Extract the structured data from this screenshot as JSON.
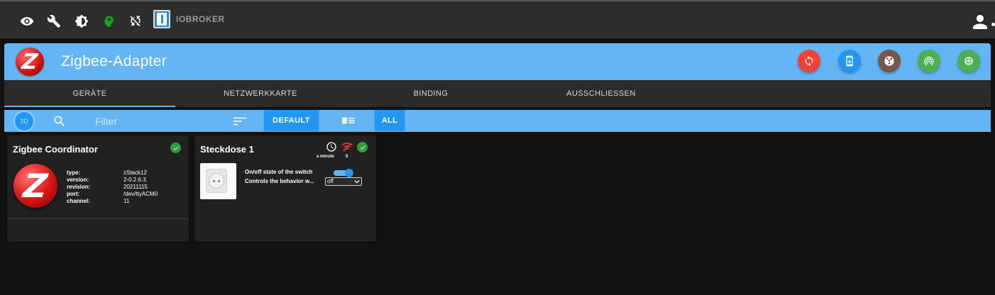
{
  "topbar": {
    "brand": "IOBROKER",
    "icons": [
      "eye-icon",
      "wrench-icon",
      "brightness-icon",
      "expert-mode-icon",
      "sync-icon"
    ]
  },
  "header": {
    "title": "Zigbee-Adapter",
    "buttons": [
      {
        "name": "refresh",
        "color": "#f44336"
      },
      {
        "name": "install",
        "color": "#2196f3"
      },
      {
        "name": "extension",
        "color": "#795548"
      },
      {
        "name": "pairing",
        "color": "#4caf50"
      },
      {
        "name": "memory",
        "color": "#4caf50"
      }
    ]
  },
  "tabs": [
    {
      "label": "GERÄTE",
      "active": true
    },
    {
      "label": "NETZWERKKARTE",
      "active": false
    },
    {
      "label": "BINDING",
      "active": false
    },
    {
      "label": "AUSSCHLIESSEN",
      "active": false
    }
  ],
  "toolbar": {
    "btn3d": "3D",
    "filter_placeholder": "Filter",
    "default_label": "DEFAULT",
    "all_label": "ALL"
  },
  "coordinator": {
    "title": "Zigbee Coordinator",
    "rows": [
      {
        "k": "type:",
        "v": "zStack12"
      },
      {
        "k": "version:",
        "v": "2-0.2.6.3."
      },
      {
        "k": "revision:",
        "v": "20211115"
      },
      {
        "k": "port:",
        "v": "/dev/ttyACM0"
      },
      {
        "k": "channel:",
        "v": "11"
      }
    ]
  },
  "device": {
    "title": "Steckdose 1",
    "last_seen": "a minute",
    "link_quality": "5",
    "state_label": "On/off state of the switch",
    "behavior_label": "Controls the behavior w...",
    "state_on": true,
    "behavior_value": "off"
  },
  "colors": {
    "accent": "#64b5f6",
    "button": "#2196f3",
    "ok": "#2e9e3a",
    "wifi_bad": "#e53935"
  }
}
